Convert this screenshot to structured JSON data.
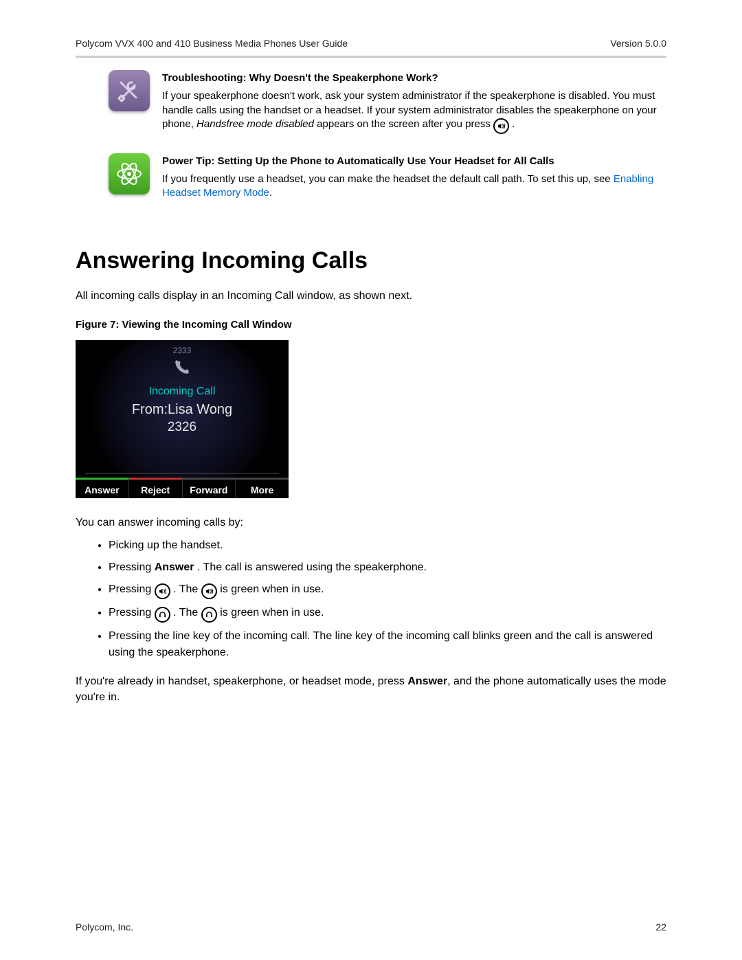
{
  "header": {
    "doc_title": "Polycom VVX 400 and 410 Business Media Phones User Guide",
    "version": "Version 5.0.0"
  },
  "callout1": {
    "title": "Troubleshooting: Why Doesn't the Speakerphone Work?",
    "text_a": "If your speakerphone doesn't work, ask your system administrator if the speakerphone is disabled. You must handle calls using the handset or a headset. If your system administrator disables the speakerphone on your phone, ",
    "italic": "Handsfree mode disabled",
    "text_b": " appears on the screen after you press ",
    "text_c": "."
  },
  "callout2": {
    "title": "Power Tip: Setting Up the Phone to Automatically Use Your Headset for All Calls",
    "text": "If you frequently use a headset, you can make the headset the default call path. To set this up, see ",
    "link": "Enabling Headset Memory Mode",
    "text_after": "."
  },
  "heading": "Answering Incoming Calls",
  "intro": "All incoming calls display in an Incoming Call window, as shown next.",
  "figure_caption": "Figure 7: Viewing the Incoming Call Window",
  "phone": {
    "top_number": "2333",
    "incoming_label": "Incoming Call",
    "from_line": "From:Lisa Wong",
    "number": "2326",
    "softkeys": [
      "Answer",
      "Reject",
      "Forward",
      "More"
    ]
  },
  "after_figure": "You can answer incoming calls by:",
  "bullets": {
    "b1": "Picking up the handset.",
    "b2_a": "Pressing ",
    "b2_bold": "Answer",
    "b2_b": ". The call is answered using the speakerphone.",
    "b3_a": "Pressing ",
    "b3_b": ". The ",
    "b3_c": " is green when in use.",
    "b4_a": "Pressing ",
    "b4_b": ". The ",
    "b4_c": " is green when in use.",
    "b5": "Pressing the line key of the incoming call. The line key of the incoming call blinks green and the call is answered using the speakerphone."
  },
  "closing_a": "If you're already in handset, speakerphone, or headset mode, press ",
  "closing_bold": "Answer",
  "closing_b": ", and the phone automatically uses the mode you're in.",
  "footer": {
    "company": "Polycom, Inc.",
    "page": "22"
  }
}
